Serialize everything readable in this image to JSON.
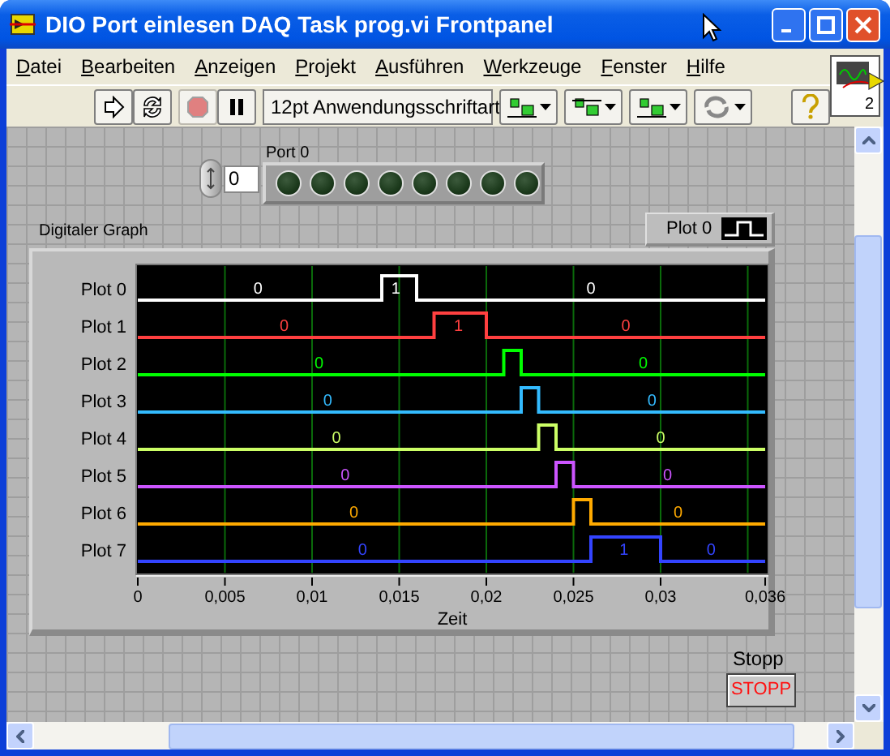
{
  "window": {
    "title": "DIO Port einlesen DAQ Task prog.vi Frontpanel"
  },
  "menu": [
    "Datei",
    "Bearbeiten",
    "Anzeigen",
    "Projekt",
    "Ausführen",
    "Werkzeuge",
    "Fenster",
    "Hilfe"
  ],
  "toolbar": {
    "font_menu": "12pt Anwendungsschriftart"
  },
  "vi_icon": {
    "number": "2"
  },
  "panel": {
    "port": {
      "label": "Port 0",
      "index": "0",
      "leds": [
        {
          "on": false
        },
        {
          "on": false
        },
        {
          "on": false
        },
        {
          "on": false
        },
        {
          "on": false
        },
        {
          "on": false
        },
        {
          "on": false
        },
        {
          "on": false
        }
      ]
    },
    "graph": {
      "label": "Digitaler Graph",
      "legend": {
        "name": "Plot 0"
      },
      "plots": [
        {
          "name": "Plot 0",
          "color": "#ffffff",
          "value_labels": [
            "0",
            "1",
            "0"
          ]
        },
        {
          "name": "Plot 1",
          "color": "#ff4040",
          "value_labels": [
            "0",
            "1",
            "0"
          ]
        },
        {
          "name": "Plot 2",
          "color": "#00ff00",
          "value_labels": [
            "0",
            "0"
          ]
        },
        {
          "name": "Plot 3",
          "color": "#33bbff",
          "value_labels": [
            "0",
            "0"
          ]
        },
        {
          "name": "Plot 4",
          "color": "#ccff66",
          "value_labels": [
            "0",
            "0"
          ]
        },
        {
          "name": "Plot 5",
          "color": "#cc55ff",
          "value_labels": [
            "0",
            "0"
          ]
        },
        {
          "name": "Plot 6",
          "color": "#ffaa00",
          "value_labels": [
            "0",
            "0"
          ]
        },
        {
          "name": "Plot 7",
          "color": "#3344ff",
          "value_labels": [
            "0",
            "1",
            "0"
          ]
        }
      ],
      "x_axis": {
        "title": "Zeit",
        "ticks": [
          "0",
          "0,005",
          "0,01",
          "0,015",
          "0,02",
          "0,025",
          "0,03",
          "0,036"
        ]
      }
    },
    "stop": {
      "label": "Stopp",
      "button": "STOPP"
    }
  }
}
